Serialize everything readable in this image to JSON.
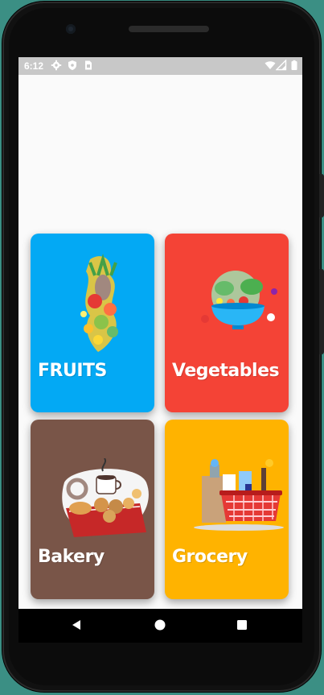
{
  "status_bar": {
    "time": "6:12",
    "left_icons": [
      "gear-icon",
      "shield-icon",
      "sim-card-icon"
    ],
    "right_icons": [
      "wifi-icon",
      "signal-icon",
      "battery-icon"
    ]
  },
  "categories": [
    {
      "label": "FRUITS",
      "color": "#03a9f4",
      "image": "fruits-illustration"
    },
    {
      "label": "Vegetables",
      "color": "#f44336",
      "image": "vegetables-bowl-illustration"
    },
    {
      "label": "Bakery",
      "color": "#795548",
      "image": "bakery-illustration"
    },
    {
      "label": "Grocery",
      "color": "#ffb300",
      "image": "grocery-basket-illustration"
    }
  ],
  "nav_bar": {
    "buttons": [
      "back-icon",
      "home-icon",
      "recents-icon"
    ]
  }
}
